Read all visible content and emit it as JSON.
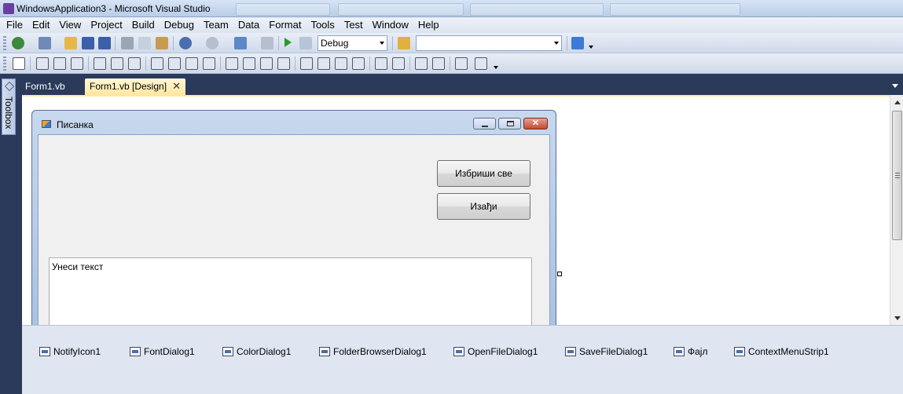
{
  "window": {
    "title": "WindowsApplication3 - Microsoft Visual Studio"
  },
  "menu": [
    "File",
    "Edit",
    "View",
    "Project",
    "Build",
    "Debug",
    "Team",
    "Data",
    "Format",
    "Tools",
    "Test",
    "Window",
    "Help"
  ],
  "toolbar": {
    "config_value": "Debug",
    "platform_value": ""
  },
  "toolbox": {
    "label": "Toolbox"
  },
  "tabs": {
    "inactive_label": "Form1.vb",
    "active_label": "Form1.vb [Design]",
    "close_glyph": "✕"
  },
  "form": {
    "title": "Писанка",
    "clear_button": "Избриши све",
    "exit_button": "Изађи",
    "textbox_value": "Унеси текст"
  },
  "tray": {
    "components": [
      "NotifyIcon1",
      "FontDialog1",
      "ColorDialog1",
      "FolderBrowserDialog1",
      "OpenFileDialog1",
      "SaveFileDialog1",
      "Фајл",
      "ContextMenuStrip1"
    ]
  }
}
